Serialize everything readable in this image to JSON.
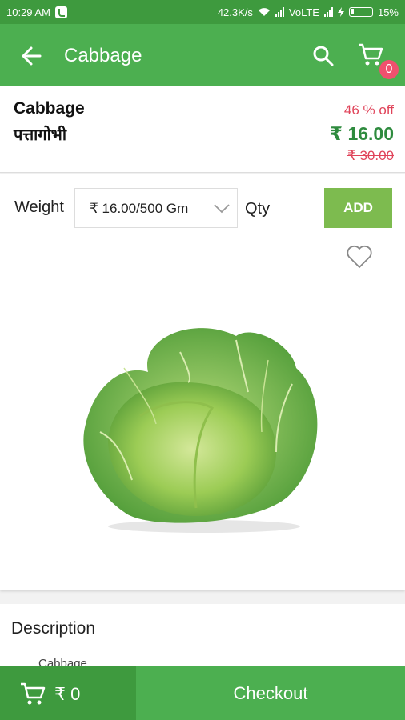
{
  "status_bar": {
    "time": "10:29 AM",
    "net_speed": "42.3K/s",
    "network": "VoLTE",
    "battery": "15%"
  },
  "app_bar": {
    "title": "Cabbage",
    "cart_count": "0"
  },
  "product": {
    "name": "Cabbage",
    "name_hindi": "पत्तागोभी",
    "discount": "46 % off",
    "price": "₹ 16.00",
    "mrp": "₹ 30.00"
  },
  "options": {
    "weight_label": "Weight",
    "weight_selected": "₹ 16.00/500 Gm",
    "qty_label": "Qty",
    "add_label": "ADD"
  },
  "description": {
    "title": "Description",
    "text": "Cabbage"
  },
  "bottom_bar": {
    "cart_total": "₹ 0",
    "checkout_label": "Checkout"
  },
  "colors": {
    "status_bar": "#3e9a3e",
    "app_bar": "#4caf50",
    "price_green": "#2e8b3e",
    "discount_red": "#e0445a",
    "add_button": "#7dbb4f"
  },
  "icons": [
    "back-arrow-icon",
    "search-icon",
    "cart-icon",
    "chevron-down-icon",
    "heart-icon",
    "cart-icon"
  ]
}
